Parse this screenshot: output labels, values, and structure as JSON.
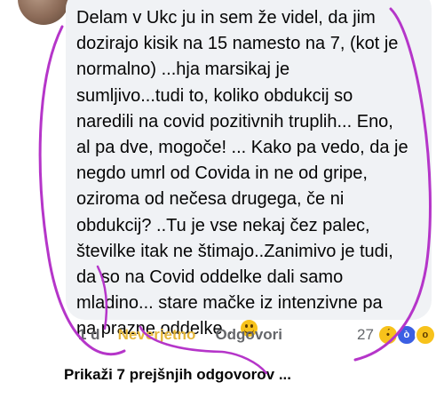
{
  "comment": {
    "lines": [
      "Delam v Ukc ju in sem  že videl, da jim",
      "dozirajo kisik na 15 namesto na 7, (kot je",
      "normalno) ...hja marsikaj je",
      "sumljivo...tudi to, koliko obdukcij so",
      "naredili na covid pozitivnih truplih... Eno,",
      "al pa dve, mogoče! ... Kako pa vedo, da je",
      "negdo umrl od Covida in ne od gripe,",
      "oziroma od nečesa drugega, če ni",
      "obdukcij? ..Tu je vse nekaj čez palec,",
      "številke itak ne štimajo..Zanimivo je tudi,",
      "da so na Covid oddelke dali samo",
      "mladino... stare mačke iz intenzivne pa",
      "na prazne oddelke.. "
    ],
    "emoji": "smiling-face-emoji"
  },
  "actions": {
    "age": "1 d",
    "reaction": "Neverjetno",
    "reply": "Odgovori"
  },
  "reactions": {
    "count": "27",
    "icons": [
      "sad-reaction-icon",
      "angry-reaction-icon",
      "wow-reaction-icon"
    ]
  },
  "more_replies": "Prikaži 7 prejšnjih odgovorov ...",
  "colors": {
    "bubble": "#f0f2f5",
    "reaction_label": "#e5b73b",
    "annotation_circle": "#b535c9"
  }
}
